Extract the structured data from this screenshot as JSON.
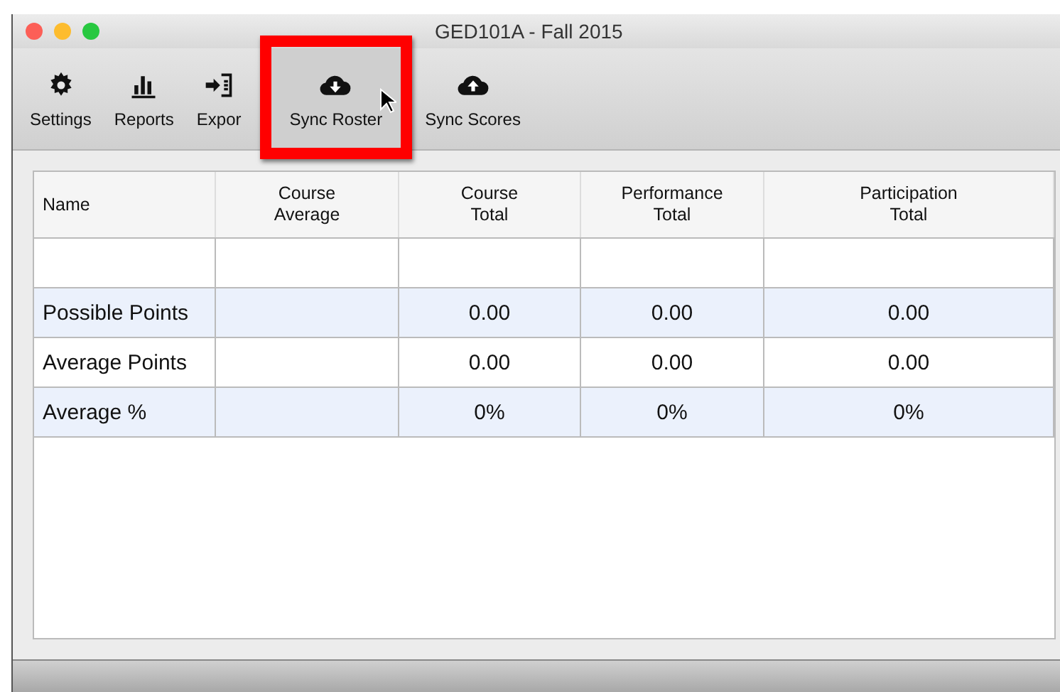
{
  "window": {
    "title": "GED101A - Fall 2015"
  },
  "toolbar": [
    {
      "label": "Settings",
      "highlighted": false
    },
    {
      "label": "Reports",
      "highlighted": false
    },
    {
      "label": "Expor",
      "highlighted": false
    },
    {
      "label": "Sync Roster",
      "highlighted": true
    },
    {
      "label": "Sync Scores",
      "highlighted": false
    }
  ],
  "table": {
    "columns": [
      "Name",
      "Course Average",
      "Course Total",
      "Performance Total",
      "Participation Total"
    ],
    "rows": [
      [
        "",
        "",
        "",
        "",
        ""
      ],
      [
        "Possible Points",
        "",
        "0.00",
        "0.00",
        "0.00"
      ],
      [
        "Average Points",
        "",
        "0.00",
        "0.00",
        "0.00"
      ],
      [
        "Average %",
        "",
        "0%",
        "0%",
        "0%"
      ]
    ]
  }
}
